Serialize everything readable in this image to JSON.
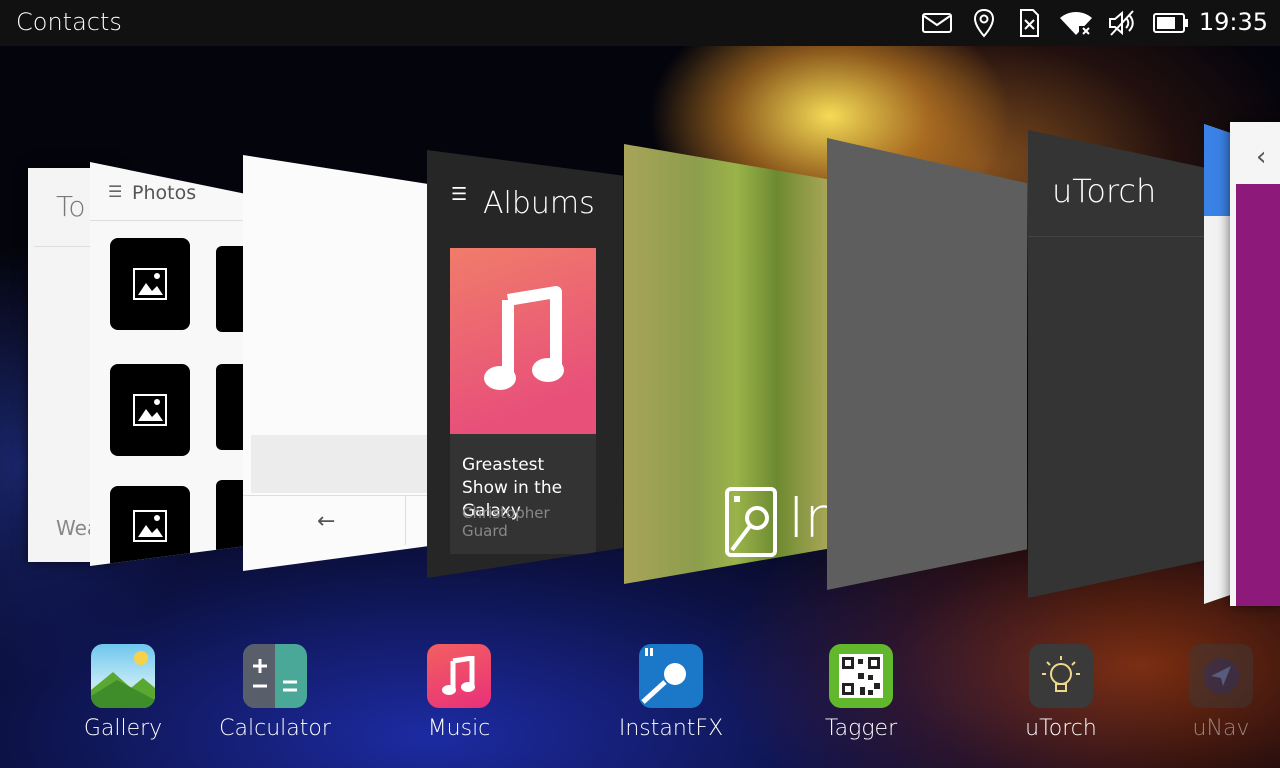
{
  "status_bar": {
    "title": "Contacts",
    "time": "19:35",
    "indicators": [
      "envelope-icon",
      "location-icon",
      "sim-missing-icon",
      "wifi-icon",
      "volume-muted-icon",
      "battery-icon"
    ]
  },
  "cards": {
    "todo": {
      "header": "To",
      "footer": "Wea"
    },
    "photos": {
      "header": "Photos"
    },
    "blank": {
      "back_glyph": "←"
    },
    "music": {
      "header": "Albums",
      "song": "Greastest Show in the Galaxy",
      "artist": "Christopher Guard"
    },
    "instantfx": {
      "label": "In"
    },
    "utorch": {
      "title": "uTorch"
    },
    "unav": {
      "back_glyph": "‹"
    }
  },
  "dock": {
    "apps": [
      {
        "label": "Gallery",
        "icon": "gallery-icon"
      },
      {
        "label": "Calculator",
        "icon": "calculator-icon"
      },
      {
        "label": "Music",
        "icon": "music-icon"
      },
      {
        "label": "InstantFX",
        "icon": "instantfx-icon"
      },
      {
        "label": "Tagger",
        "icon": "qr-code-icon"
      },
      {
        "label": "uTorch",
        "icon": "lightbulb-icon"
      },
      {
        "label": "uNav",
        "icon": "navigation-icon"
      }
    ]
  },
  "colors": {
    "accent_blue": "#3b82e6",
    "music_pink": "#e8507a",
    "instantfx_blue": "#1b78c8",
    "tagger_green": "#62b82c"
  }
}
